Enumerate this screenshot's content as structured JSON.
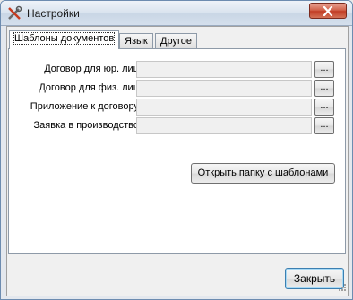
{
  "window": {
    "title": "Настройки",
    "icons": {
      "app": "settings-tools-icon",
      "close": "close-icon"
    }
  },
  "tabs": [
    {
      "label": "Шаблоны документов",
      "active": true
    },
    {
      "label": "Язык",
      "active": false
    },
    {
      "label": "Другое",
      "active": false
    }
  ],
  "templates": {
    "rows": [
      {
        "label": "Договор для юр. лиц",
        "value": "",
        "browse_label": "..."
      },
      {
        "label": "Договор для физ. лиц",
        "value": "",
        "browse_label": "..."
      },
      {
        "label": "Приложение к договору",
        "value": "",
        "browse_label": "..."
      },
      {
        "label": "Заявка в производство",
        "value": "",
        "browse_label": "..."
      }
    ],
    "open_folder_label": "Открыть папку с шаблонами"
  },
  "footer": {
    "close_label": "Закрыть"
  },
  "colors": {
    "close_button": "#c13d25",
    "frame": "#6d8cb0",
    "default_button_border": "#3c7fb1"
  }
}
